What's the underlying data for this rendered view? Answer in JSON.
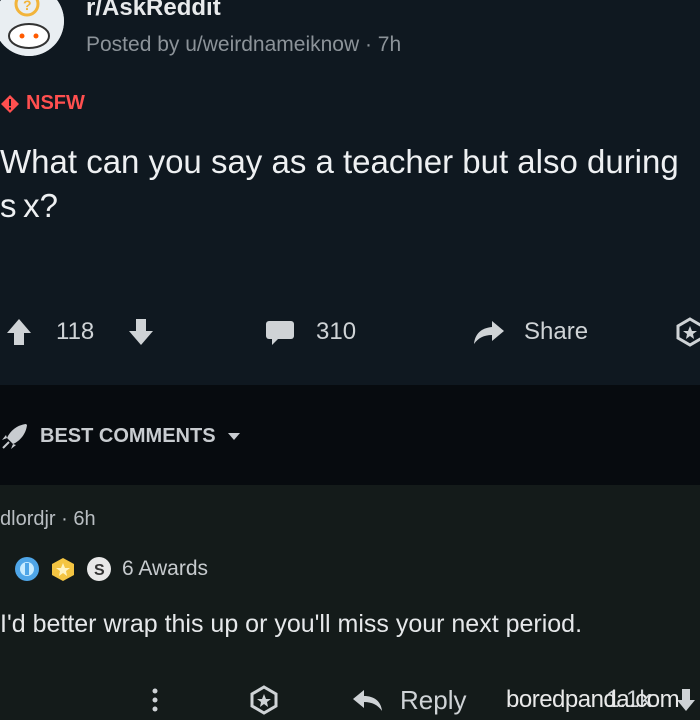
{
  "post": {
    "subreddit": "r/AskReddit",
    "posted_by": "Posted by u/weirdnameiknow · 7h",
    "nsfw_label": "NSFW",
    "title": "What can you say as a teacher but also during s x?",
    "upvotes": "118",
    "comments": "310",
    "share_label": "Share"
  },
  "sort": {
    "label": "BEST COMMENTS"
  },
  "comment": {
    "author": "dlordjr · 6h",
    "awards_label": "6 Awards",
    "text": "I'd better wrap this up or you'll miss your next period.",
    "reply_label": "Reply",
    "score": "1.1k"
  },
  "watermark": "boredpanda.com",
  "colors": {
    "nsfw": "#ff4f4f",
    "background": "#0f1820",
    "comment_background": "#141b1a"
  }
}
